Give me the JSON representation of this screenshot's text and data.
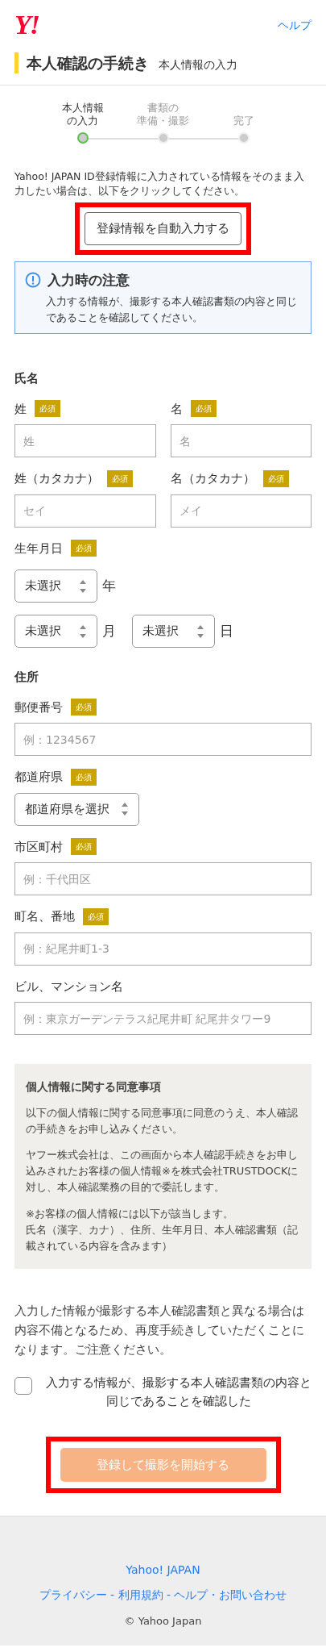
{
  "header": {
    "logo": "Y!",
    "help_link": "ヘルプ"
  },
  "page_title": {
    "title": "本人確認の手続き",
    "subtitle": "本人情報の入力"
  },
  "steps": [
    {
      "lines": [
        "本人情報",
        "の入力"
      ],
      "selected": true
    },
    {
      "lines": [
        "書類の",
        "準備・撮影"
      ],
      "selected": false
    },
    {
      "lines": [
        "完了"
      ],
      "selected": false
    }
  ],
  "autofill": {
    "text": "Yahoo! JAPAN ID登録情報に入力されている情報をそのまま入力したい場合は、以下をクリックしてください。",
    "button": "登録情報を自動入力する",
    "highlighted": true
  },
  "notice": {
    "title": "入力時の注意",
    "text": "入力する情報が、撮影する本人確認書類の内容と同じであることを確認してください。"
  },
  "form": [
    {
      "kind": "heading",
      "text": "氏名"
    },
    {
      "kind": "pair",
      "fields": [
        {
          "label": "姓",
          "badge": "必須",
          "placeholder": "姓"
        },
        {
          "label": "名",
          "badge": "必須",
          "placeholder": "名"
        }
      ]
    },
    {
      "kind": "pair",
      "fields": [
        {
          "label": "姓（カタカナ）",
          "badge": "必須",
          "placeholder": "セイ"
        },
        {
          "label": "名（カタカナ）",
          "badge": "必須",
          "placeholder": "メイ"
        }
      ]
    },
    {
      "kind": "date",
      "label": "生年月日",
      "badge": "必須",
      "rows": [
        [
          {
            "value": "未選択",
            "unit": "年"
          }
        ],
        [
          {
            "value": "未選択",
            "unit": "月"
          },
          {
            "value": "未選択",
            "unit": "日"
          }
        ]
      ]
    },
    {
      "kind": "heading",
      "text": "住所"
    },
    {
      "kind": "text",
      "label": "郵便番号",
      "badge": "必須",
      "placeholder": "例：1234567"
    },
    {
      "kind": "select",
      "label": "都道府県",
      "badge": "必須",
      "value": "都道府県を選択"
    },
    {
      "kind": "text",
      "label": "市区町村",
      "badge": "必須",
      "placeholder": "例：千代田区"
    },
    {
      "kind": "text",
      "label": "町名、番地",
      "badge": "必須",
      "placeholder": "例：紀尾井町1-3"
    },
    {
      "kind": "text",
      "label": "ビル、マンション名",
      "placeholder": "例：東京ガーデンテラス紀尾井町 紀尾井タワー9"
    }
  ],
  "consent": {
    "title": "個人情報に関する同意事項",
    "paragraphs": [
      "以下の個人情報に関する同意事項に同意のうえ、本人確認の手続きをお申し込みください。",
      "ヤフー株式会社は、この画面から本人確認手続きをお申し込みされたお客様の個人情報※を株式会社TRUSTDOCKに対し、本人確認業務の目的で委託します。",
      "※お客様の個人情報には以下が該当します。"
    ],
    "note_detail": "氏名（漢字、カナ）、住所、生年月日、本人確認書類（記載されている内容を含みます）"
  },
  "warning": "入力した情報が撮影する本人確認書類と異なる場合は内容不備となるため、再度手続きしていただくことになります。ご注意ください。",
  "confirm": {
    "label": "入力する情報が、撮影する本人確認書類の内容と同じであることを確認した",
    "checked": false
  },
  "submit": {
    "label": "登録して撮影を開始する",
    "disabled": true,
    "highlighted": true
  },
  "footer": {
    "brand": "Yahoo! JAPAN",
    "links": [
      {
        "label": "プライバシー"
      },
      {
        "separator": " - ",
        "label": "利用規約"
      },
      {
        "separator": " - ",
        "label": "ヘルプ"
      },
      {
        "separator": "・",
        "label": "お問い合わせ"
      }
    ],
    "copyright": "© Yahoo Japan"
  }
}
